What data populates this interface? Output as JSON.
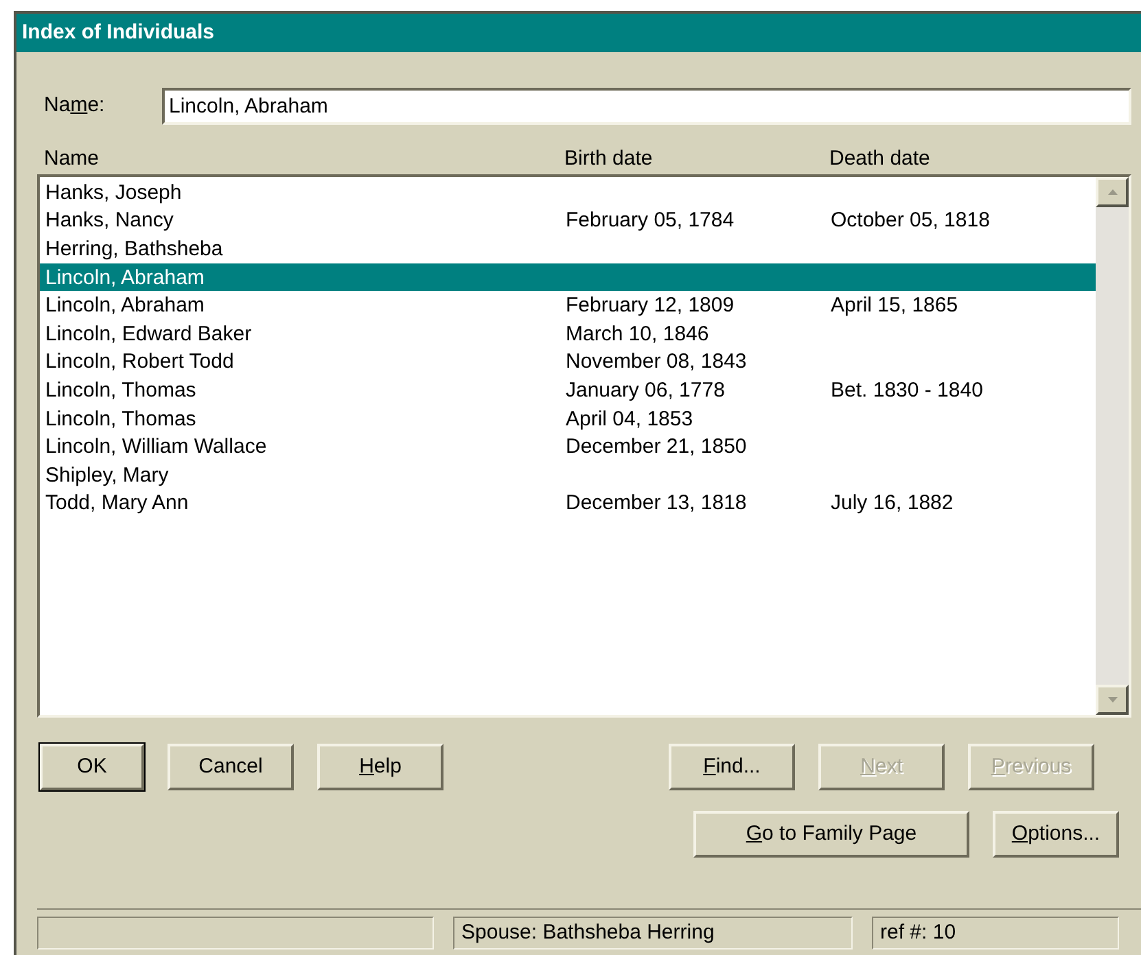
{
  "window": {
    "title": "Index of Individuals"
  },
  "name_field": {
    "label": {
      "before": "Na",
      "key": "m",
      "after": "e:"
    },
    "value": "Lincoln, Abraham"
  },
  "list": {
    "columns": [
      "Name",
      "Birth date",
      "Death date"
    ],
    "rows": [
      {
        "name": "Hanks, Joseph",
        "selected": false
      },
      {
        "name": "Hanks, Nancy",
        "birth": "February 05, 1784",
        "death": "October 05, 1818",
        "selected": false
      },
      {
        "name": "Herring, Bathsheba",
        "selected": false
      },
      {
        "name": "Lincoln, Abraham",
        "selected": true
      },
      {
        "name": "Lincoln, Abraham",
        "birth": "February 12, 1809",
        "death": "April 15, 1865",
        "selected": false
      },
      {
        "name": "Lincoln, Edward Baker",
        "birth": "March 10, 1846",
        "selected": false
      },
      {
        "name": "Lincoln, Robert Todd",
        "birth": "November 08, 1843",
        "selected": false
      },
      {
        "name": "Lincoln, Thomas",
        "birth": "January 06, 1778",
        "death": "Bet. 1830 - 1840",
        "selected": false
      },
      {
        "name": "Lincoln, Thomas",
        "birth": "April 04, 1853",
        "selected": false
      },
      {
        "name": "Lincoln, William Wallace",
        "birth": "December 21, 1850",
        "selected": false
      },
      {
        "name": "Shipley, Mary",
        "selected": false
      },
      {
        "name": "Todd, Mary Ann",
        "birth": "December 13, 1818",
        "death": "July 16, 1882",
        "selected": false
      }
    ]
  },
  "buttons_left": [
    {
      "label": {
        "after": "OK"
      },
      "default": true,
      "disabled": false
    },
    {
      "label": {
        "after": "Cancel"
      },
      "default": false,
      "disabled": false
    },
    {
      "label": {
        "key": "H",
        "after": "elp"
      },
      "default": false,
      "disabled": false
    }
  ],
  "buttons_right": [
    {
      "label": {
        "key": "F",
        "after": "ind..."
      },
      "default": false,
      "disabled": false
    },
    {
      "label": {
        "key": "N",
        "after": "ext"
      },
      "default": false,
      "disabled": true
    },
    {
      "label": {
        "key": "P",
        "after": "revious"
      },
      "default": false,
      "disabled": true
    }
  ],
  "buttons_bottom": [
    {
      "label": {
        "key": "G",
        "after": "o to Family Page"
      },
      "default": false,
      "disabled": false
    },
    {
      "label": {
        "key": "O",
        "after": "ptions..."
      },
      "default": false,
      "disabled": false
    }
  ],
  "status_bar": {
    "spouse": "Spouse: Bathsheba Herring",
    "ref": "ref #: 10"
  }
}
